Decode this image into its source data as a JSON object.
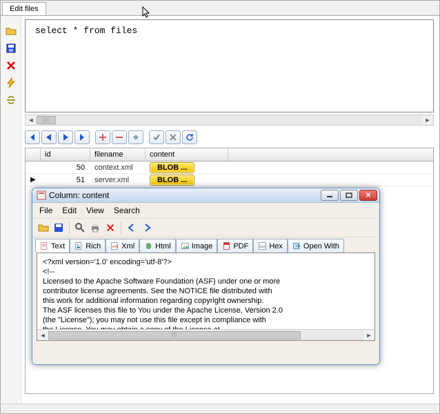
{
  "tab": {
    "label": "Edit files"
  },
  "sql": {
    "text": "select * from files"
  },
  "grid": {
    "headers": {
      "id": "id",
      "filename": "filename",
      "content": "content"
    },
    "rows": [
      {
        "id": "50",
        "filename": "context.xml",
        "content": "BLOB ..."
      },
      {
        "id": "51",
        "filename": "server.xml",
        "content": "BLOB ..."
      }
    ]
  },
  "window": {
    "title": "Column: content",
    "menu": {
      "file": "File",
      "edit": "Edit",
      "view": "View",
      "search": "Search"
    },
    "tabs": {
      "text": "Text",
      "rich": "Rich",
      "xml": "Xml",
      "html": "Html",
      "image": "Image",
      "pdf": "PDF",
      "hex": "Hex",
      "open_with": "Open With"
    },
    "content_lines": [
      "<?xml version='1.0' encoding='utf-8'?>",
      "<!--",
      "  Licensed to the Apache Software Foundation (ASF) under one or more",
      "  contributor license agreements.  See the NOTICE file distributed with",
      "  this work for additional information regarding copyright ownership.",
      "  The ASF licenses this file to You under the Apache License, Version 2.0",
      "  (the \"License\"); you may not use this file except in compliance with",
      "  the License.  You may obtain a copy of the License at"
    ]
  }
}
